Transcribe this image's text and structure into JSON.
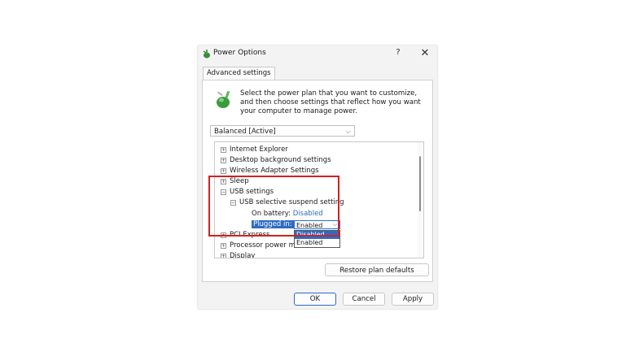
{
  "window": {
    "title": "Power Options",
    "help": "?",
    "close": "✕"
  },
  "tab": {
    "label": "Advanced settings"
  },
  "description": "Select the power plan that you want to customize, and then choose settings that reflect how you want your computer to manage power.",
  "plan_select": {
    "value": "Balanced [Active]"
  },
  "tree": {
    "items": [
      {
        "label": "Internet Explorer",
        "expander": "+"
      },
      {
        "label": "Desktop background settings",
        "expander": "+"
      },
      {
        "label": "Wireless Adapter Settings",
        "expander": "+"
      },
      {
        "label": "Sleep",
        "expander": "+"
      },
      {
        "label": "USB settings",
        "expander": "−"
      },
      {
        "label": "USB selective suspend setting",
        "expander": "−"
      },
      {
        "label": "PCI Express",
        "expander": "+"
      },
      {
        "label": "Processor power m",
        "expander": "+"
      },
      {
        "label": "Display",
        "expander": "+"
      }
    ],
    "on_battery": {
      "label": "On battery:",
      "value": "Disabled"
    },
    "plugged_in": {
      "label": "Plugged in:",
      "value": "Enabled"
    },
    "dropdown_options": [
      "Disabled",
      "Enabled"
    ]
  },
  "buttons": {
    "restore": "Restore plan defaults",
    "ok": "OK",
    "cancel": "Cancel",
    "apply": "Apply"
  },
  "colors": {
    "accent": "#2d6bc4",
    "highlight_box": "#d42020",
    "link": "#2f6db5"
  }
}
